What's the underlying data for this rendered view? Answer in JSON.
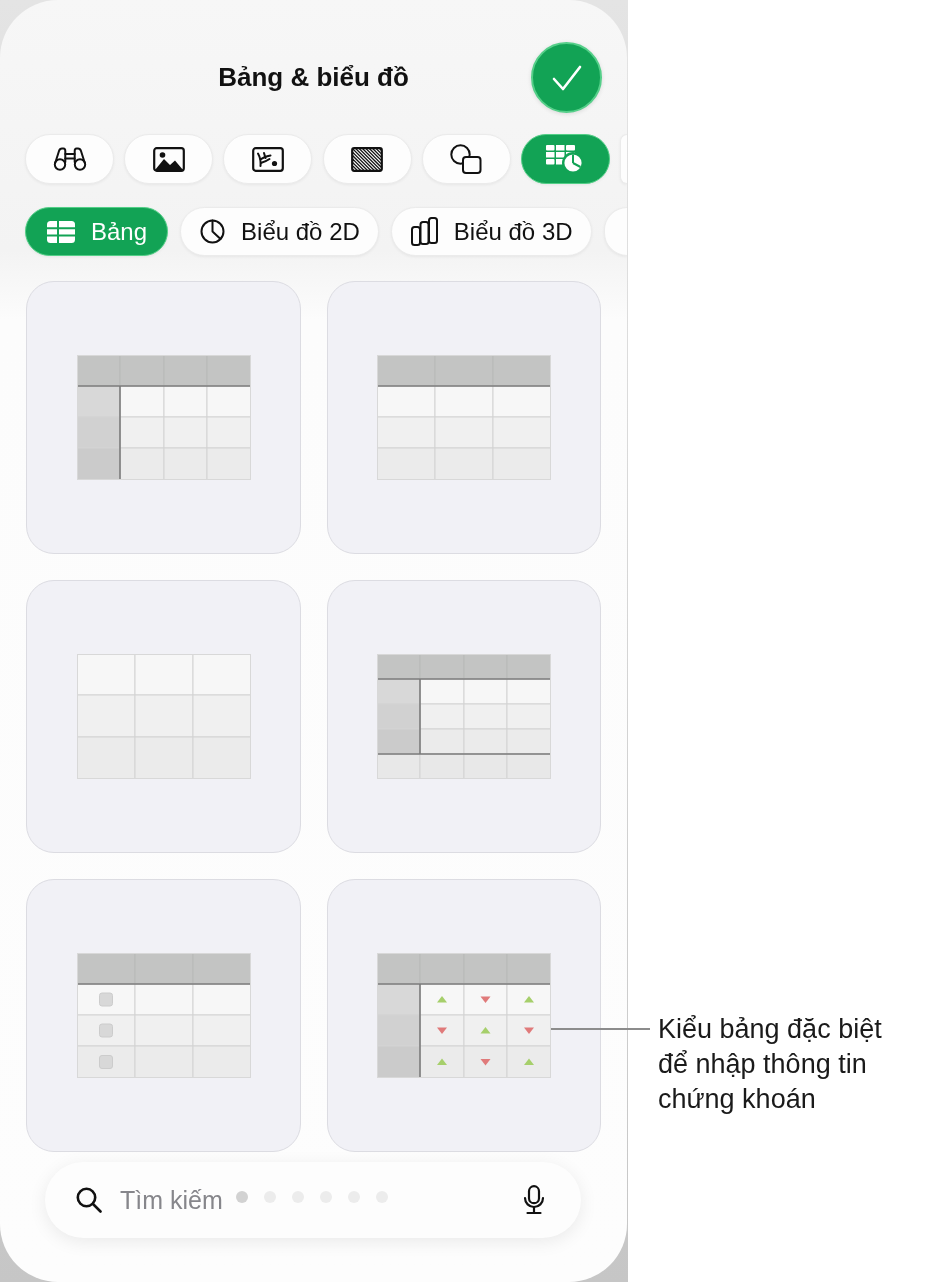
{
  "header": {
    "title": "Bảng & biểu đồ"
  },
  "insert_tabs": [
    {
      "kind": "binoculars",
      "selected": false
    },
    {
      "kind": "image",
      "selected": false
    },
    {
      "kind": "sketch",
      "selected": false
    },
    {
      "kind": "hatch",
      "selected": false
    },
    {
      "kind": "shapes",
      "selected": false
    },
    {
      "kind": "table_chart",
      "selected": true
    },
    {
      "selected": false
    }
  ],
  "category_tabs": [
    {
      "kind": "table",
      "label": "Bảng",
      "selected": true
    },
    {
      "kind": "chart_2d",
      "label": "Biểu đồ 2D",
      "selected": false
    },
    {
      "kind": "chart_3d",
      "label": "Biểu đồ 3D",
      "selected": false
    },
    {
      "selected": false
    }
  ],
  "table_styles": [
    {
      "kind": "header_row_column"
    },
    {
      "kind": "header_row"
    },
    {
      "kind": "plain"
    },
    {
      "kind": "header_row_column_footer"
    },
    {
      "kind": "checkbox",
      "rows": [
        {
          "checked": false
        },
        {
          "checked": false
        },
        {
          "checked": false
        }
      ]
    },
    {
      "kind": "stock",
      "trend_rows": [
        [
          {
            "rising": true
          },
          {
            "rising": false
          },
          {
            "rising": true
          }
        ],
        [
          {
            "rising": false
          },
          {
            "rising": true
          },
          {
            "rising": false
          }
        ],
        [
          {
            "rising": true
          },
          {
            "rising": false
          },
          {
            "rising": true
          }
        ]
      ]
    }
  ],
  "callout": {
    "text": "Kiểu bảng đặc biệt để nhập thông tin chứng khoán"
  },
  "search": {
    "placeholder": "Tìm kiếm"
  },
  "page_indicator": [
    {
      "selected": true
    },
    {
      "selected": false
    },
    {
      "selected": false
    },
    {
      "selected": false
    },
    {
      "selected": false
    },
    {
      "selected": false
    }
  ]
}
